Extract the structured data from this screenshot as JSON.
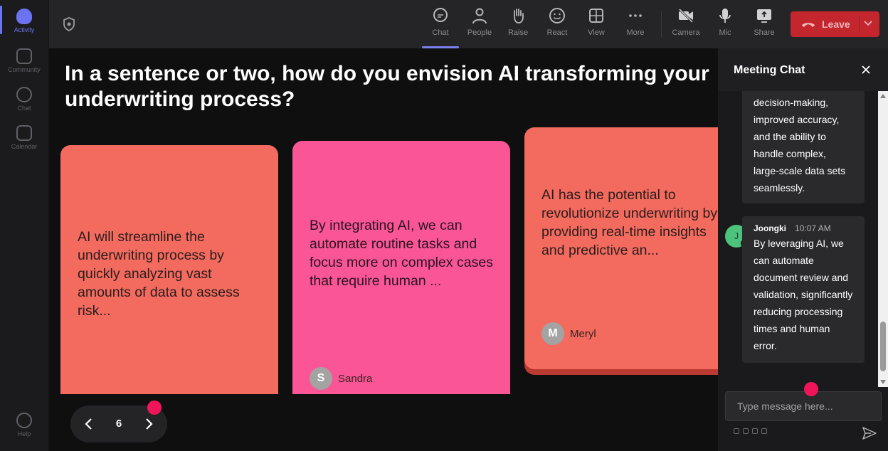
{
  "rail": {
    "items": [
      {
        "label": "Activity",
        "icon": "bell-icon",
        "active": true
      },
      {
        "label": "Community",
        "icon": "community-icon"
      },
      {
        "label": "Chat",
        "icon": "chat-icon"
      },
      {
        "label": "Calendar",
        "icon": "calendar-icon"
      }
    ],
    "help": {
      "label": "Help",
      "icon": "help-icon"
    }
  },
  "toolbar": {
    "buttons": [
      {
        "label": "Chat",
        "icon": "chat-bubble-icon",
        "active": true
      },
      {
        "label": "People",
        "icon": "people-icon"
      },
      {
        "label": "Raise",
        "icon": "raise-hand-icon"
      },
      {
        "label": "React",
        "icon": "smiley-icon"
      },
      {
        "label": "View",
        "icon": "grid-view-icon"
      },
      {
        "label": "More",
        "icon": "more-dots-icon"
      },
      {
        "label": "Camera",
        "icon": "camera-off-icon"
      },
      {
        "label": "Mic",
        "icon": "mic-icon"
      },
      {
        "label": "Share",
        "icon": "share-screen-icon"
      }
    ],
    "leave_label": "Leave",
    "leave_color": "#c4262e"
  },
  "stage": {
    "question": "In a sentence or two, how do you envision AI transforming your underwriting process?",
    "cards": [
      {
        "text": "AI will streamline the underwriting process by quickly analyzing vast amounts of data to assess risk...",
        "color": "#f26b5e"
      },
      {
        "text": "By integrating AI, we can automate routine tasks and focus more on complex cases that require human ...",
        "author": "Sandra",
        "initial": "S",
        "color": "#fa5695"
      },
      {
        "text": "AI has the potential to revolutionize underwriting by providing real-time insights and predictive an...",
        "author": "Meryl",
        "initial": "M",
        "color": "#f26b5e"
      }
    ],
    "page_number": "6"
  },
  "chat": {
    "title": "Meeting Chat",
    "messages": [
      {
        "text": "decision-making, improved accuracy, and the ability to handle complex, large-scale data sets seamlessly."
      },
      {
        "author": "Joongki",
        "initial": "J",
        "time": "10:07 AM",
        "text": "By leveraging AI, we can automate document review and validation, significantly reducing processing times and human error."
      }
    ],
    "input_placeholder": "Type message here..."
  },
  "colors": {
    "accent": "#7a80ee",
    "marker": "#f0145a"
  }
}
